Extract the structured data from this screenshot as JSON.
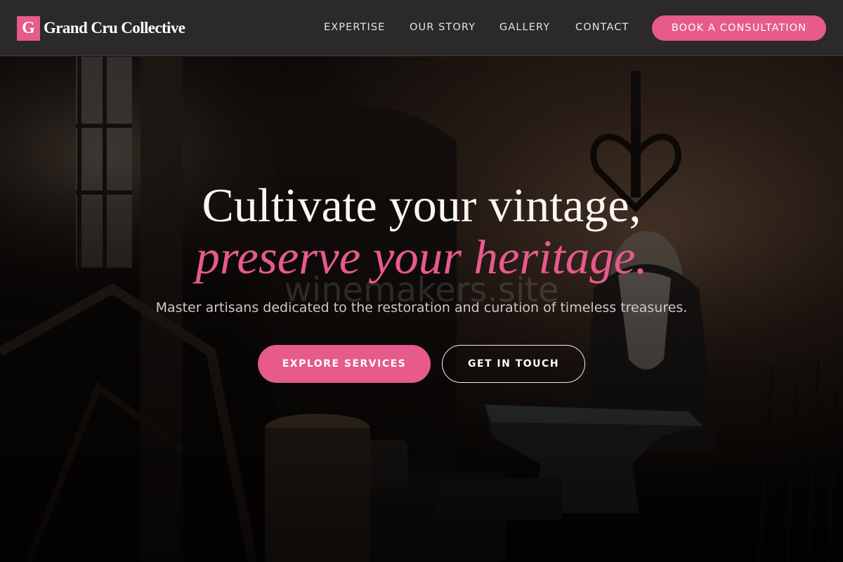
{
  "brand": {
    "logo_letter": "G",
    "name": "Grand Cru Collective"
  },
  "nav": {
    "items": [
      {
        "label": "EXPERTISE"
      },
      {
        "label": "OUR STORY"
      },
      {
        "label": "GALLERY"
      },
      {
        "label": "CONTACT"
      }
    ],
    "cta_label": "BOOK A CONSULTATION"
  },
  "hero": {
    "headline_line1": "Cultivate your vintage,",
    "headline_line2": "preserve your heritage.",
    "watermark": "winemakers.site",
    "subtitle": "Master artisans dedicated to the restoration and curation of timeless treasures.",
    "primary_cta": "EXPLORE SERVICES",
    "secondary_cta": "GET IN TOUCH"
  },
  "colors": {
    "accent": "#e65a8c",
    "header_bg": "#2b2929",
    "headline": "#fbf5f3"
  }
}
